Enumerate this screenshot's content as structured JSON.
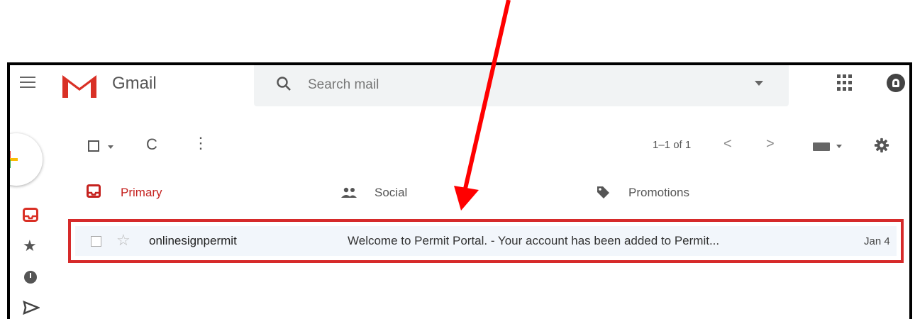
{
  "header": {
    "app_title": "Gmail",
    "search_placeholder": "Search mail"
  },
  "toolbar": {
    "refresh_glyph": "C",
    "more_glyph": "⋮",
    "pager": "1–1 of 1",
    "prev_glyph": "<",
    "next_glyph": ">"
  },
  "tabs": [
    {
      "label": "Primary",
      "icon": "inbox-icon",
      "selected": true
    },
    {
      "label": "Social",
      "icon": "people-icon",
      "selected": false
    },
    {
      "label": "Promotions",
      "icon": "tag-icon",
      "selected": false
    }
  ],
  "emails": [
    {
      "sender": "onlinesignpermit",
      "subject": "Welcome to Permit Portal. - Your account has been added to Permit...",
      "date": "Jan 4",
      "starred": false
    }
  ],
  "sidebar": {
    "icons": [
      "inbox-icon",
      "star-icon",
      "clock-icon",
      "send-icon"
    ]
  },
  "colors": {
    "accent_red": "#c5221f",
    "highlight_border": "#d62a2a",
    "annotation_arrow": "#ff0000"
  }
}
